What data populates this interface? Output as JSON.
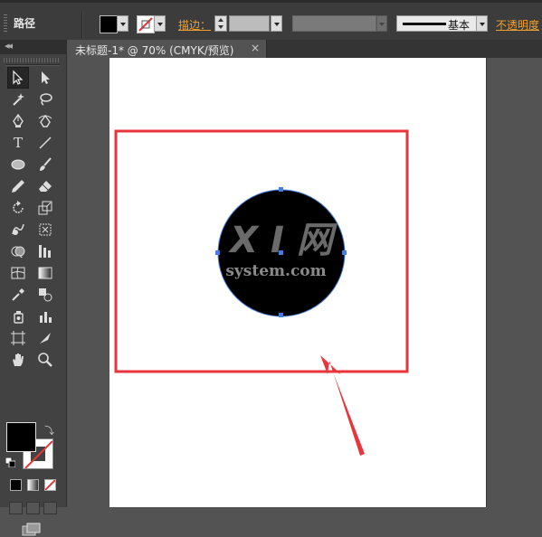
{
  "control_bar": {
    "object_type": "路径",
    "stroke_label": "描边：",
    "brush_definition": "基本",
    "opacity_label": "不透明度"
  },
  "document": {
    "tab_title": "未标题-1* @ 70% (CMYK/预览)",
    "close_glyph": "×"
  },
  "tools_panel": {
    "collapse_glyph": "◂◂",
    "tools": [
      "selection",
      "direct-selection",
      "magic-wand",
      "lasso",
      "pen",
      "curvature-pen",
      "type",
      "line-segment",
      "ellipse",
      "paintbrush",
      "pencil",
      "eraser",
      "rotate",
      "scale",
      "warp",
      "free-transform",
      "shape-builder",
      "graph",
      "mesh",
      "gradient",
      "eyedropper",
      "blend",
      "symbol-sprayer",
      "column-graph",
      "artboard",
      "slice",
      "hand",
      "zoom"
    ],
    "fill_color": "#000000",
    "stroke_color": "none"
  },
  "canvas": {
    "watermark_line1": "X I 网",
    "watermark_line2": "system.com",
    "shape_fill": "#000000",
    "selection_color": "#4a7bd8",
    "highlight_color": "#e8353a"
  }
}
